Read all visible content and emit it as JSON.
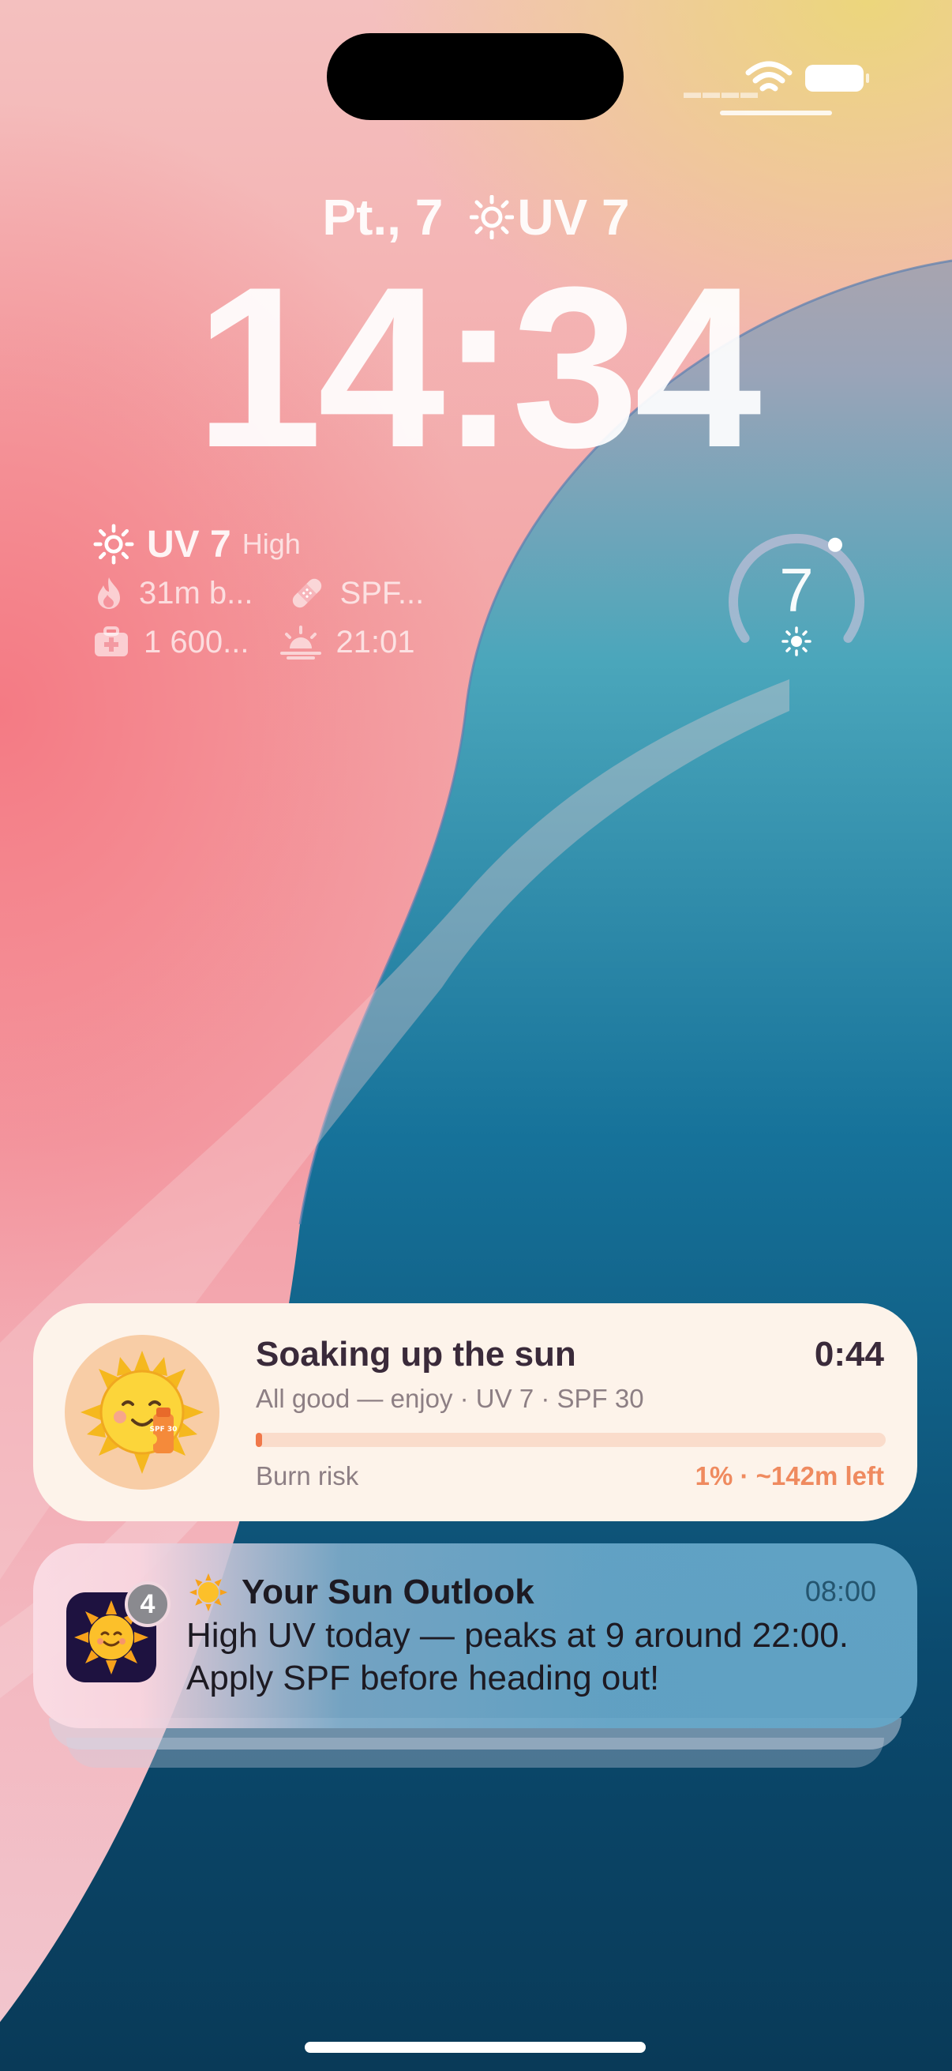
{
  "lockscreen": {
    "date": "Pt., 7",
    "uv_header": "UV 7",
    "time": "14:34"
  },
  "widget": {
    "uv_label": "UV 7",
    "uv_level": "High",
    "burn_time": "31m b...",
    "spf": "SPF...",
    "vitamin": "1 600...",
    "sunset": "21:01"
  },
  "gauge": {
    "value": "7",
    "fraction": 0.64
  },
  "live_activity": {
    "title": "Soaking up the sun",
    "timer": "0:44",
    "subtitle": "All good — enjoy · UV 7 · SPF 30",
    "progress_label": "Burn risk",
    "progress_value": "1% · ~142m left",
    "progress_fraction": 0.01,
    "sticker_text": "SPF 30"
  },
  "notification": {
    "badge": "4",
    "title": "Your Sun Outlook",
    "time": "08:00",
    "body": "High UV today — peaks at 9 around 22:00. Apply SPF before heading out!"
  },
  "colors": {
    "accent_orange": "#f0784a",
    "card_bg": "#fdf3ea",
    "notif_blue": "#68a8ca"
  }
}
